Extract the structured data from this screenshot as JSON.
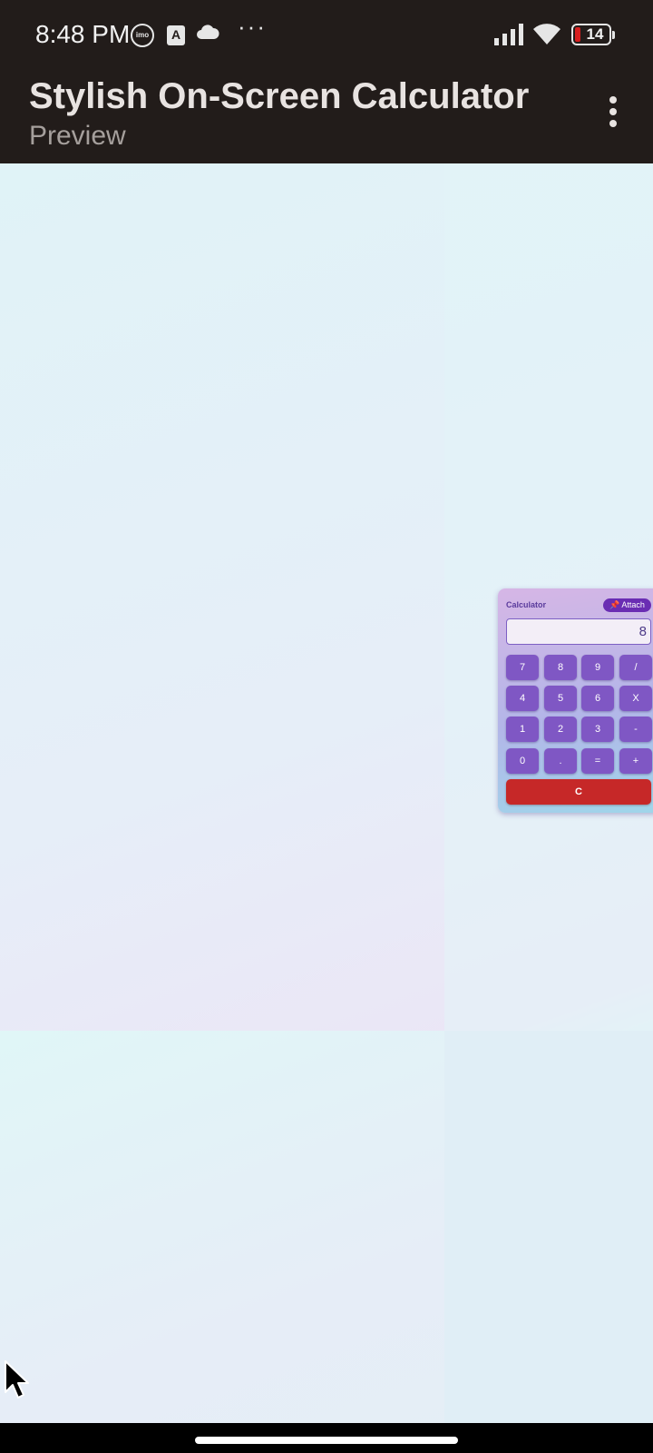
{
  "status_bar": {
    "time": "8:48 PM",
    "notification_icons": [
      "imo-icon",
      "translate-a-icon",
      "cloud-icon",
      "more-dots-icon"
    ],
    "imo_label": "imo",
    "a_label": "A",
    "dots": "···",
    "battery_level": "14",
    "battery_color": "#d61f1f"
  },
  "app_bar": {
    "title": "Stylish On-Screen Calculator",
    "subtitle": "Preview",
    "background": "#221c1a"
  },
  "calculator": {
    "title": "Calculator",
    "attach_label": "📌 Attach",
    "display_value": "8",
    "keys": [
      [
        "7",
        "8",
        "9",
        "/"
      ],
      [
        "4",
        "5",
        "6",
        "X"
      ],
      [
        "1",
        "2",
        "3",
        "-"
      ],
      [
        "0",
        ".",
        "=",
        "+"
      ]
    ],
    "clear_label": "C",
    "key_color": "#7f57c4",
    "clear_color": "#c62828"
  }
}
